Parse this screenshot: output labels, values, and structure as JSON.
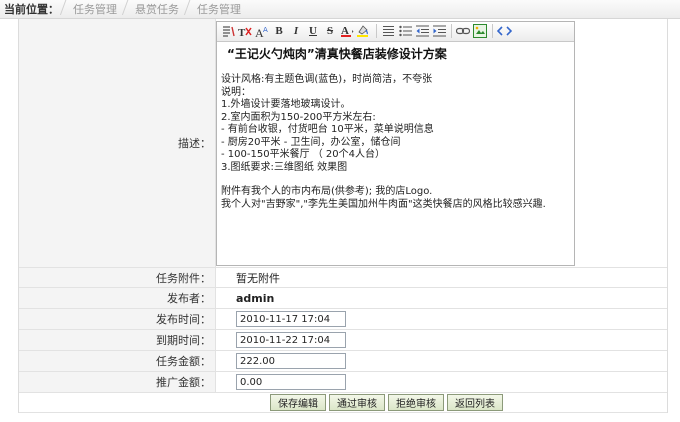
{
  "breadcrumb": {
    "label": "当前位置：",
    "items": [
      "任务管理",
      "悬赏任务",
      "任务管理"
    ]
  },
  "fields": {
    "description_label": "描述：",
    "attachment_label": "任务附件：",
    "attachment_value": "暂无附件",
    "publisher_label": "发布者：",
    "publisher_value": "admin",
    "publish_time_label": "发布时间：",
    "publish_time_value": "2010-11-17 17:04",
    "deadline_label": "到期时间：",
    "deadline_value": "2010-11-22 17:04",
    "amount_label": "任务金额：",
    "amount_value": "222.00",
    "promo_label": "推广金额：",
    "promo_value": "0.00"
  },
  "editor": {
    "title": "“王记火勺炖肉”清真快餐店装修设计方案",
    "lines1": [
      "设计风格:有主题色调(蓝色)，时尚简洁，不夸张",
      "说明：",
      "1.外墙设计要落地玻璃设计。",
      "2.室内面积为150-200平方米左右:",
      "- 有前台收银，付货吧台  10平米，菜单说明信息",
      "- 厨房20平米  - 卫生间，办公室，储仓间",
      "- 100-150平米餐厅 （ 20个4人台）",
      "3.图纸要求:三维图纸  效果图"
    ],
    "lines2": [
      "附件有我个人的市内布局(供参考); 我的店Logo.",
      "我个人对\"吉野家\",\"李先生美国加州牛肉面\"这类快餐店的风格比较感兴趣."
    ]
  },
  "buttons": {
    "save": "保存编辑",
    "approve": "通过审核",
    "reject": "拒绝审核",
    "back": "返回列表"
  }
}
